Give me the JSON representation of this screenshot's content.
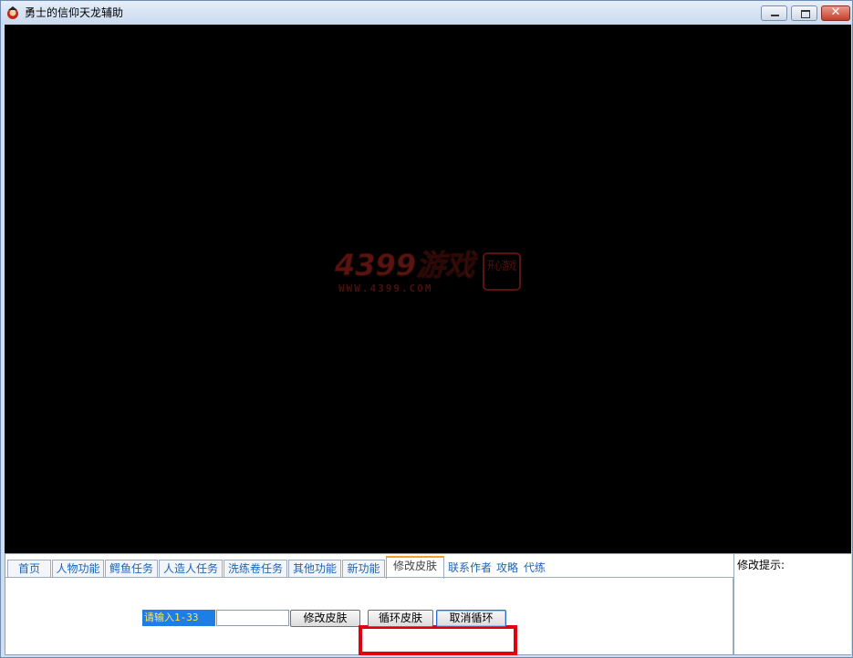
{
  "window": {
    "title": "勇士的信仰天龙辅助",
    "close_glyph": "✕"
  },
  "logo": {
    "brand": "4399游戏",
    "url": "WWW.4399.COM",
    "seal": "开心游戏"
  },
  "tabs": [
    {
      "label": "首页"
    },
    {
      "label": "人物功能"
    },
    {
      "label": "鳄鱼任务"
    },
    {
      "label": "人造人任务"
    },
    {
      "label": "洗练卷任务"
    },
    {
      "label": "其他功能"
    },
    {
      "label": "新功能"
    },
    {
      "label": "修改皮肤",
      "active": true
    },
    {
      "label": "联系作者"
    },
    {
      "label": "攻略"
    },
    {
      "label": "代练"
    }
  ],
  "skin_panel": {
    "prompt": "请输入1-33",
    "input_value": "",
    "modify_button": "修改皮肤",
    "loop_button": "循环皮肤",
    "cancel_button": "取消循环"
  },
  "hint": {
    "label": "修改提示:"
  },
  "colors": {
    "highlight_box": "#e00010",
    "prompt_bg": "#1d7ee8",
    "prompt_text": "#ffe84a",
    "tab_text": "#1b64b8"
  }
}
